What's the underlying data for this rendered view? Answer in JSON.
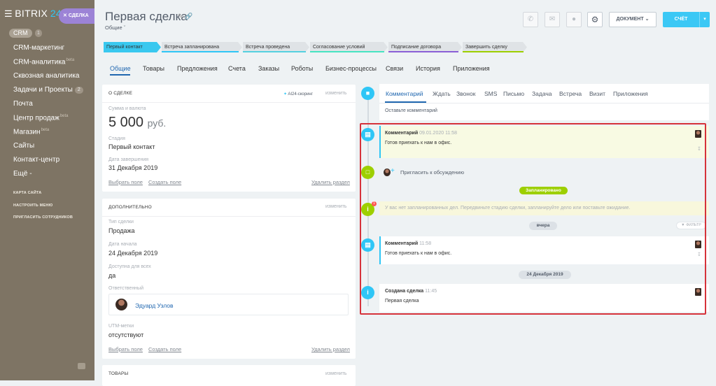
{
  "sidebar": {
    "logo_text": "BITRIX",
    "logo_num": "24",
    "deal_chip": "СДЕЛКА",
    "crm_badge": "CRM",
    "crm_count": "1",
    "items": [
      {
        "label": "CRM-маркетинг",
        "sup": "",
        "count": ""
      },
      {
        "label": "CRM-аналитика",
        "sup": "beta",
        "count": ""
      },
      {
        "label": "Сквозная аналитика",
        "sup": "",
        "count": ""
      },
      {
        "label": "Задачи и Проекты",
        "sup": "",
        "count": "2"
      },
      {
        "label": "Почта",
        "sup": "",
        "count": ""
      },
      {
        "label": "Центр продаж",
        "sup": "beta",
        "count": ""
      },
      {
        "label": "Магазин",
        "sup": "beta",
        "count": ""
      },
      {
        "label": "Сайты",
        "sup": "",
        "count": ""
      },
      {
        "label": "Контакт-центр",
        "sup": "",
        "count": ""
      },
      {
        "label": "Ещё -",
        "sup": "",
        "count": ""
      }
    ],
    "small_links": [
      "КАРТА САЙТА",
      "НАСТРОИТЬ МЕНЮ",
      "ПРИГЛАСИТЬ СОТРУДНИКОВ"
    ]
  },
  "header": {
    "title": "Первая сделка",
    "subtitle": "Общие",
    "document_label": "ДОКУМЕНТ",
    "invoice_label": "СЧЁТ"
  },
  "stages": [
    {
      "label": "Первый контакт",
      "color": "#39c8ef"
    },
    {
      "label": "Встреча запланирована",
      "color": "#2fc6f6"
    },
    {
      "label": "Встреча проведена",
      "color": "#55d0e0"
    },
    {
      "label": "Согласование условий",
      "color": "#47e4c2"
    },
    {
      "label": "Подписание договора",
      "color": "#8a5fd6"
    },
    {
      "label": "Завершить сделку",
      "color": "#9dcf00"
    }
  ],
  "tabs": [
    "Общие",
    "Товары",
    "Предложения",
    "Счета",
    "Заказы",
    "Роботы",
    "Бизнес-процессы",
    "Связи",
    "История",
    "Приложения"
  ],
  "about": {
    "heading": "О СДЕЛКЕ",
    "scoring": "AI24-скоринг",
    "edit": "изменить",
    "sum_label": "Сумма и валюта",
    "sum_value": "5 000",
    "sum_currency": "руб.",
    "stage_label": "Стадия",
    "stage_value": "Первый контакт",
    "close_label": "Дата завершения",
    "close_value": "31 Декабря 2019",
    "select_field": "Выбрать поле",
    "create_field": "Создать поле",
    "delete_section": "Удалить раздел"
  },
  "extra": {
    "heading": "ДОПОЛНИТЕЛЬНО",
    "edit": "изменить",
    "type_label": "Тип сделки",
    "type_value": "Продажа",
    "start_label": "Дата начала",
    "start_value": "24 Декабря 2019",
    "public_label": "Доступна для всех",
    "public_value": "да",
    "resp_label": "Ответственный",
    "resp_name": "Эдуард Узлов",
    "utm_label": "UTM-метки",
    "utm_value": "отсутствуют",
    "select_field": "Выбрать поле",
    "create_field": "Создать поле",
    "delete_section": "Удалить раздел"
  },
  "products": {
    "heading": "ТОВАРЫ",
    "edit": "изменить"
  },
  "editor": {
    "tabs": [
      "Комментарий",
      "Ждать",
      "Звонок",
      "SMS",
      "Письмо",
      "Задача",
      "Встреча",
      "Визит",
      "Приложения"
    ],
    "placeholder": "Оставьте комментарий"
  },
  "timeline": {
    "pinned_title": "Комментарий",
    "pinned_time": "09.01.2020 11:58",
    "pinned_text": "Готов приехать к нам в офис.",
    "invite": "Пригласить к обсуждению",
    "planned_badge": "Запланировано",
    "warning": "У вас нет запланированных дел. Передвиньте стадию сделки, запланируйте дело или поставьте ожидание.",
    "warning_count": "1",
    "yesterday_badge": "вчера",
    "filter": "ФИЛЬТР",
    "comment_title": "Комментарий",
    "comment_time": "11:58",
    "comment_text": "Готов приехать к нам в офис.",
    "date_badge": "24 Декабря 2019",
    "created_title": "Создана сделка",
    "created_time": "11:45",
    "created_text": "Первая сделка"
  },
  "colors": {
    "sidebar": "#7e7464",
    "accent": "#2fc6f6",
    "link": "#2067b0",
    "green": "#9dcf00",
    "highlight_frame": "#d6323a"
  }
}
